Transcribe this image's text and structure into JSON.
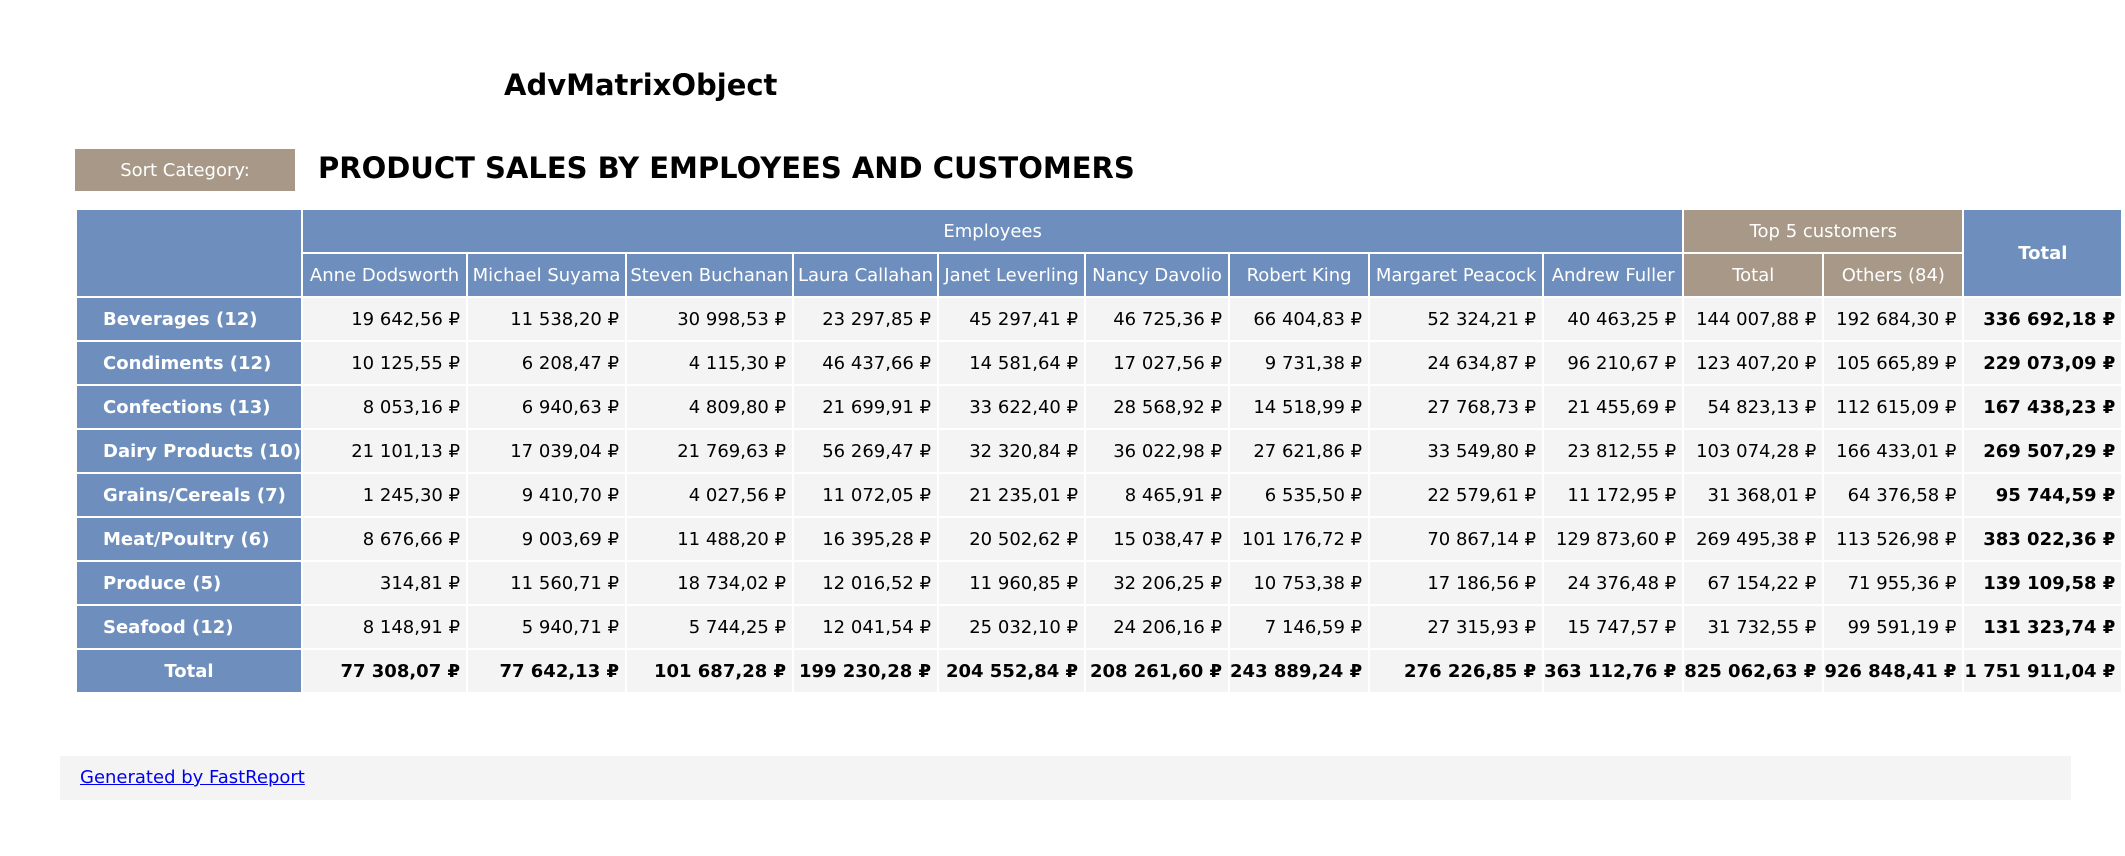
{
  "title": "AdvMatrixObject",
  "sort_button_label": "Sort Category:",
  "report_heading": "PRODUCT SALES BY EMPLOYEES AND CUSTOMERS",
  "matrix": {
    "employees_group_label": "Employees",
    "customers_group_label": "Top 5 customers",
    "grand_total_header": "Total",
    "columns": [
      "Anne Dodsworth",
      "Michael Suyama",
      "Steven Buchanan",
      "Laura Callahan",
      "Janet Leverling",
      "Nancy Davolio",
      "Robert King",
      "Margaret Peacock",
      "Andrew Fuller",
      "Total",
      "Others (84)"
    ],
    "rows": [
      {
        "label": "Beverages (12)",
        "values": [
          "19 642,56 ₽",
          "11 538,20 ₽",
          "30 998,53 ₽",
          "23 297,85 ₽",
          "45 297,41 ₽",
          "46 725,36 ₽",
          "66 404,83 ₽",
          "52 324,21 ₽",
          "40 463,25 ₽",
          "144 007,88 ₽",
          "192 684,30 ₽"
        ],
        "total": "336 692,18 ₽"
      },
      {
        "label": "Condiments (12)",
        "values": [
          "10 125,55 ₽",
          "6 208,47 ₽",
          "4 115,30 ₽",
          "46 437,66 ₽",
          "14 581,64 ₽",
          "17 027,56 ₽",
          "9 731,38 ₽",
          "24 634,87 ₽",
          "96 210,67 ₽",
          "123 407,20 ₽",
          "105 665,89 ₽"
        ],
        "total": "229 073,09 ₽"
      },
      {
        "label": "Confections (13)",
        "values": [
          "8 053,16 ₽",
          "6 940,63 ₽",
          "4 809,80 ₽",
          "21 699,91 ₽",
          "33 622,40 ₽",
          "28 568,92 ₽",
          "14 518,99 ₽",
          "27 768,73 ₽",
          "21 455,69 ₽",
          "54 823,13 ₽",
          "112 615,09 ₽"
        ],
        "total": "167 438,23 ₽"
      },
      {
        "label": "Dairy Products (10)",
        "values": [
          "21 101,13 ₽",
          "17 039,04 ₽",
          "21 769,63 ₽",
          "56 269,47 ₽",
          "32 320,84 ₽",
          "36 022,98 ₽",
          "27 621,86 ₽",
          "33 549,80 ₽",
          "23 812,55 ₽",
          "103 074,28 ₽",
          "166 433,01 ₽"
        ],
        "total": "269 507,29 ₽"
      },
      {
        "label": "Grains/Cereals (7)",
        "values": [
          "1 245,30 ₽",
          "9 410,70 ₽",
          "4 027,56 ₽",
          "11 072,05 ₽",
          "21 235,01 ₽",
          "8 465,91 ₽",
          "6 535,50 ₽",
          "22 579,61 ₽",
          "11 172,95 ₽",
          "31 368,01 ₽",
          "64 376,58 ₽"
        ],
        "total": "95 744,59 ₽"
      },
      {
        "label": "Meat/Poultry (6)",
        "values": [
          "8 676,66 ₽",
          "9 003,69 ₽",
          "11 488,20 ₽",
          "16 395,28 ₽",
          "20 502,62 ₽",
          "15 038,47 ₽",
          "101 176,72 ₽",
          "70 867,14 ₽",
          "129 873,60 ₽",
          "269 495,38 ₽",
          "113 526,98 ₽"
        ],
        "total": "383 022,36 ₽"
      },
      {
        "label": "Produce (5)",
        "values": [
          "314,81 ₽",
          "11 560,71 ₽",
          "18 734,02 ₽",
          "12 016,52 ₽",
          "11 960,85 ₽",
          "32 206,25 ₽",
          "10 753,38 ₽",
          "17 186,56 ₽",
          "24 376,48 ₽",
          "67 154,22 ₽",
          "71 955,36 ₽"
        ],
        "total": "139 109,58 ₽"
      },
      {
        "label": "Seafood (12)",
        "values": [
          "8 148,91 ₽",
          "5 940,71 ₽",
          "5 744,25 ₽",
          "12 041,54 ₽",
          "25 032,10 ₽",
          "24 206,16 ₽",
          "7 146,59 ₽",
          "27 315,93 ₽",
          "15 747,57 ₽",
          "31 732,55 ₽",
          "99 591,19 ₽"
        ],
        "total": "131 323,74 ₽"
      }
    ],
    "totals_row": {
      "label": "Total",
      "values": [
        "77 308,07 ₽",
        "77 642,13 ₽",
        "101 687,28 ₽",
        "199 230,28 ₽",
        "204 552,84 ₽",
        "208 261,60 ₽",
        "243 889,24 ₽",
        "276 226,85 ₽",
        "363 112,76 ₽",
        "825 062,63 ₽",
        "926 848,41 ₽"
      ],
      "total": "1 751 911,04 ₽"
    }
  },
  "footer_link": "Generated by FastReport",
  "colors": {
    "header_blue": "#6e8fbd",
    "header_tan": "#a89887",
    "cell_bg": "#f4f4f4",
    "link": "#0000ee"
  }
}
